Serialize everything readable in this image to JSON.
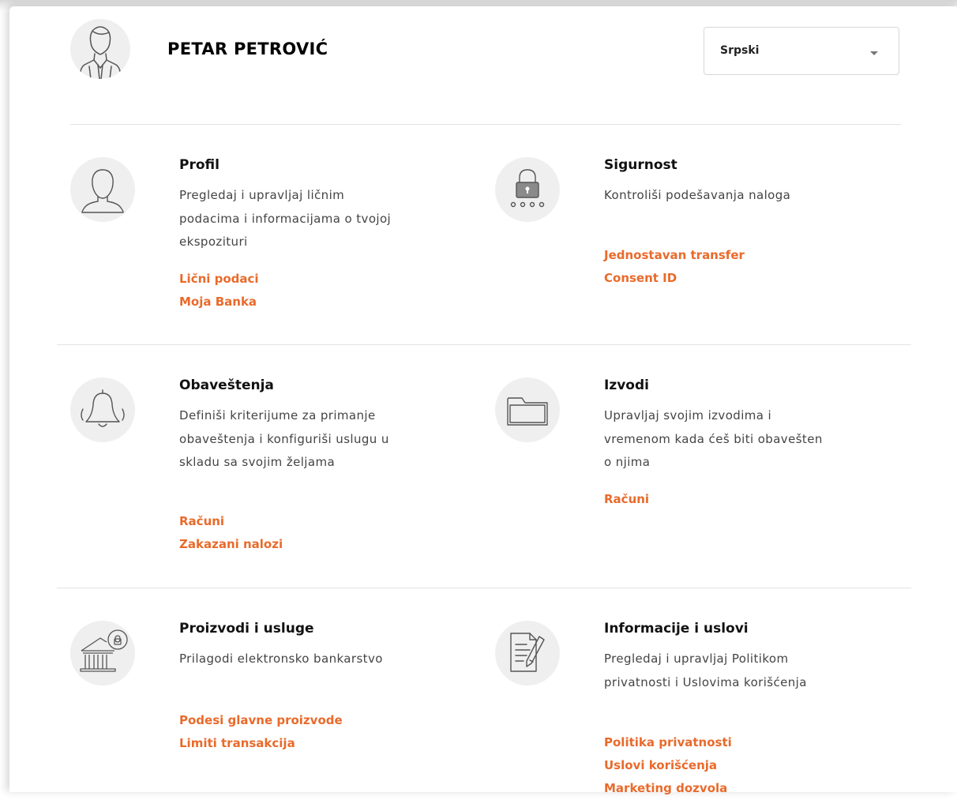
{
  "header": {
    "user_name": "PETAR PETROVIĆ",
    "language": {
      "selected": "Srpski"
    }
  },
  "cards": [
    {
      "title": "Profil",
      "description": "Pregledaj i upravljaj ličnim podacima i informacijama o tvojoj ekspozituri",
      "icon": "user-icon",
      "links": [
        "Lični podaci",
        "Moja Banka"
      ]
    },
    {
      "title": "Sigurnost",
      "description": "Kontroliši podešavanja naloga",
      "icon": "lock-icon",
      "links": [
        "Jednostavan transfer",
        "Consent ID"
      ]
    },
    {
      "title": "Obaveštenja",
      "description": "Definiši kriterijume za primanje obaveštenja i konfiguriši uslugu u skladu sa svojim željama",
      "icon": "bell-icon",
      "links": [
        "Računi",
        "Zakazani nalozi"
      ]
    },
    {
      "title": "Izvodi",
      "description": "Upravljaj svojim izvodima i vremenom kada ćeš biti obavešten o njima",
      "icon": "folder-icon",
      "links": [
        "Računi"
      ]
    },
    {
      "title": "Proizvodi i usluge",
      "description": "Prilagodi elektronsko bankarstvo",
      "icon": "bank-icon",
      "links": [
        "Podesi glavne proizvode",
        "Limiti transakcija"
      ]
    },
    {
      "title": "Informacije i uslovi",
      "description": "Pregledaj i upravljaj Politikom privatnosti i Uslovima korišćenja",
      "icon": "document-pen-icon",
      "links": [
        "Politika privatnosti",
        "Uslovi korišćenja",
        "Marketing dozvola"
      ]
    }
  ],
  "colors": {
    "accent": "#e96a2b",
    "icon_bg": "#efefef",
    "divider": "#e3e3e3"
  }
}
